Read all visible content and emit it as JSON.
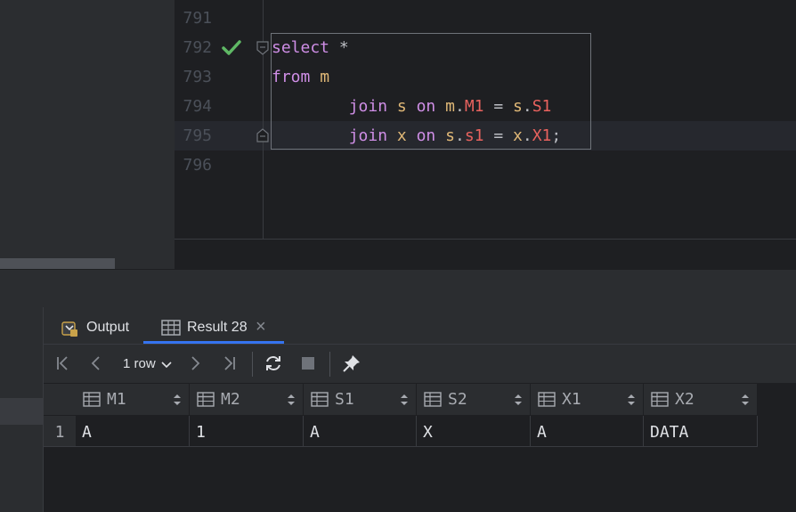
{
  "editor": {
    "line_numbers": [
      "791",
      "792",
      "793",
      "794",
      "795",
      "796"
    ],
    "code": {
      "l792": {
        "kw": "select",
        "rest": " *"
      },
      "l793": {
        "kw": "from",
        "table": "m"
      },
      "l794": {
        "indent": "        ",
        "kw1": "join",
        "t1": "s",
        "kw2": "on",
        "t2": "m",
        "c2": "M1",
        "eq": "=",
        "t3": "s",
        "c3": "S1"
      },
      "l795": {
        "indent": "        ",
        "kw1": "join",
        "t1": "x",
        "kw2": "on",
        "t2": "s",
        "c2": "s1",
        "eq": "=",
        "t3": "x",
        "c3": "X1",
        "end": ";"
      }
    },
    "status_icon": "check-icon",
    "accent_check": "#5fb865"
  },
  "tabs": [
    {
      "label": "Output",
      "icon": "output-icon"
    },
    {
      "label": "Result 28",
      "icon": "table-icon",
      "close": "×",
      "active": true
    }
  ],
  "toolbar": {
    "rows_label": "1 row",
    "buttons": [
      "first-page-icon",
      "prev-page-icon",
      "next-page-icon",
      "last-page-icon",
      "refresh-icon",
      "stop-icon",
      "pin-icon"
    ]
  },
  "grid": {
    "columns": [
      "M1",
      "M2",
      "S1",
      "S2",
      "X1",
      "X2"
    ],
    "rows": [
      {
        "num": "1",
        "cells": [
          "A",
          "1",
          "A",
          "X",
          "A",
          "DATA"
        ]
      }
    ]
  }
}
